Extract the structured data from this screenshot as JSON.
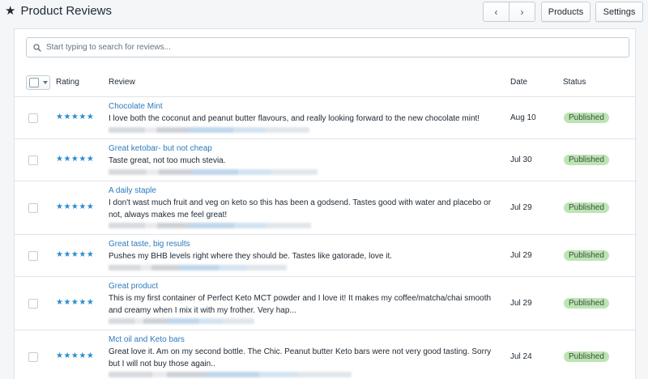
{
  "header": {
    "star_glyph": "★",
    "title": "Product Reviews",
    "prev_glyph": "‹",
    "next_glyph": "›",
    "products_label": "Products",
    "settings_label": "Settings"
  },
  "search": {
    "placeholder": "Start typing to search for reviews...",
    "value": ""
  },
  "table": {
    "columns": {
      "rating": "Rating",
      "review": "Review",
      "date": "Date",
      "status": "Status"
    },
    "rows": [
      {
        "stars": "★★★★★",
        "rating": 5,
        "title": "Chocolate Mint",
        "body": "I love both the coconut and peanut butter flavours, and really looking forward to the new chocolate mint!",
        "date": "Aug 10",
        "status": "Published"
      },
      {
        "stars": "★★★★★",
        "rating": 5,
        "title": "Great ketobar- but not cheap",
        "body": "Taste great, not too much stevia.",
        "date": "Jul 30",
        "status": "Published"
      },
      {
        "stars": "★★★★★",
        "rating": 5,
        "title": "A daily staple",
        "body": "I don't wast much fruit and veg on keto so this has been a godsend. Tastes good with water and placebo or not, always makes me feel great!",
        "date": "Jul 29",
        "status": "Published"
      },
      {
        "stars": "★★★★★",
        "rating": 5,
        "title": "Great taste, big results",
        "body": "Pushes my BHB levels right where they should be. Tastes like gatorade, love it.",
        "date": "Jul 29",
        "status": "Published"
      },
      {
        "stars": "★★★★★",
        "rating": 5,
        "title": "Great product",
        "body": "This is my first container of Perfect Keto MCT powder and I love it! It makes my coffee/matcha/chai smooth and creamy when I mix it with my frother. Very hap...",
        "date": "Jul 29",
        "status": "Published"
      },
      {
        "stars": "★★★★★",
        "rating": 5,
        "title": "Mct oil and Keto bars",
        "body": "Great love it. Am on my second bottle. The Chic. Peanut butter Keto bars were not very good tasting. Sorry but I will not buy those again..",
        "date": "Jul 24",
        "status": "Published"
      }
    ]
  },
  "colors": {
    "star": "#2a8ccf",
    "link": "#2c7bbd",
    "published_badge": "#bbe5b3"
  }
}
